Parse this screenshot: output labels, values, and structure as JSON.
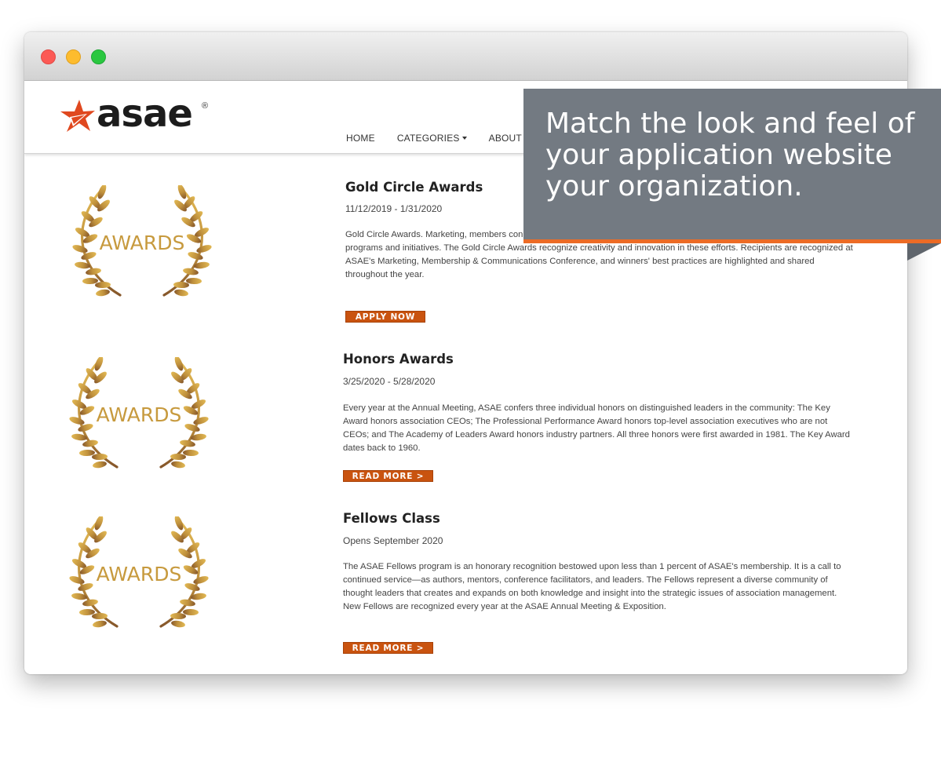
{
  "site": {
    "logo_text": "asae",
    "logo_reg": "®",
    "nav": [
      {
        "label": "HOME"
      },
      {
        "label": "CATEGORIES",
        "dropdown": true
      },
      {
        "label": "ABOUT"
      }
    ]
  },
  "awards": [
    {
      "badge": "AWARDS",
      "title": "Gold Circle Awards",
      "date": "11/12/2019 - 1/31/2020",
      "description": "Gold Circle Awards. Marketing, members connect with members, keep them informed of important issues, or raise awareness of programs and initiatives. The Gold Circle Awards recognize creativity and innovation in these efforts. Recipients are recognized at ASAE's Marketing, Membership & Communications Conference, and winners' best practices are highlighted and shared throughout the year.",
      "button": "APPLY NOW"
    },
    {
      "badge": "AWARDS",
      "title": "Honors Awards",
      "date": "3/25/2020 - 5/28/2020",
      "description": "Every year at the Annual Meeting, ASAE confers three individual honors on distinguished leaders in the community: The Key Award honors association CEOs; The Professional Performance Award honors top-level association executives who are not CEOs; and The Academy of Leaders Award honors industry partners. All three honors were first awarded in 1981. The Key Award dates back to 1960.",
      "button": "READ MORE >"
    },
    {
      "badge": "AWARDS",
      "title": "Fellows Class",
      "date": "Opens September 2020",
      "description": "The ASAE Fellows program is an honorary recognition bestowed upon less than 1 percent of ASAE's membership. It is a call to continued service—as authors, mentors, conference facilitators, and leaders. The Fellows represent a diverse community of thought leaders that creates and expands on both knowledge and insight into the strategic issues of association management. New Fellows are recognized every year at the ASAE Annual Meeting & Exposition.",
      "button": "READ MORE >"
    }
  ],
  "callout": {
    "text": "Match the look and feel of your application website your organization."
  },
  "colors": {
    "accent": "#c9530f",
    "callout_bg": "#737a82",
    "callout_stripe": "#ec6b25",
    "logo_star": "#e0481f",
    "laurel_gold": "#c79a3e"
  }
}
